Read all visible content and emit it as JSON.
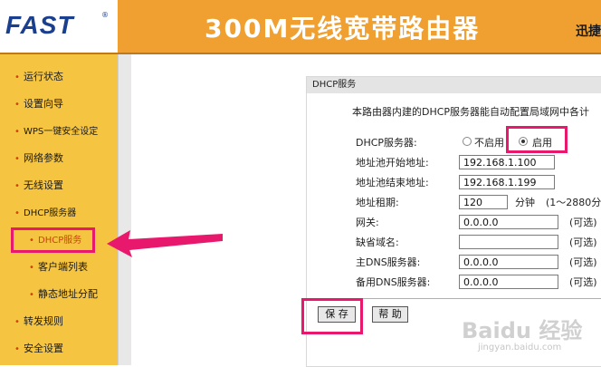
{
  "header": {
    "logo": "FAST",
    "logo_reg": "®",
    "title": "300M无线宽带路由器",
    "brand": "迅捷"
  },
  "sidebar": {
    "items": [
      {
        "label": "运行状态"
      },
      {
        "label": "设置向导"
      },
      {
        "label": "WPS一键安全设定"
      },
      {
        "label": "网络参数"
      },
      {
        "label": "无线设置"
      },
      {
        "label": "DHCP服务器"
      },
      {
        "label": "DHCP服务"
      },
      {
        "label": "客户端列表"
      },
      {
        "label": "静态地址分配"
      },
      {
        "label": "转发规则"
      },
      {
        "label": "安全设置"
      }
    ],
    "bullet": "•",
    "active_item": "DHCP服务"
  },
  "panel": {
    "title": "DHCP服务",
    "description": "本路由器内建的DHCP服务器能自动配置局域网中各计",
    "fields": {
      "dhcp_server_label": "DHCP服务器:",
      "disable_label": "不启用",
      "enable_label": "启用",
      "enabled": true,
      "start_label": "地址池开始地址:",
      "start_value": "192.168.1.100",
      "end_label": "地址池结束地址:",
      "end_value": "192.168.1.199",
      "lease_label": "地址租期:",
      "lease_value": "120",
      "lease_unit": "分钟",
      "lease_hint": "(1～2880分",
      "gateway_label": "网关:",
      "gateway_value": "0.0.0.0",
      "domain_label": "缺省域名:",
      "domain_value": "",
      "dns1_label": "主DNS服务器:",
      "dns1_value": "0.0.0.0",
      "dns2_label": "备用DNS服务器:",
      "dns2_value": "0.0.0.0",
      "optional_hint": "(可选)"
    },
    "buttons": {
      "save": "保 存",
      "help": "帮 助"
    }
  },
  "watermark": {
    "text": "Baidu 经验",
    "sub": "jingyan.baidu.com"
  },
  "colors": {
    "header_orange": "#f0a030",
    "sidebar_yellow": "#f5c542",
    "highlight_pink": "#e8186c",
    "logo_blue": "#1b3f8f"
  }
}
